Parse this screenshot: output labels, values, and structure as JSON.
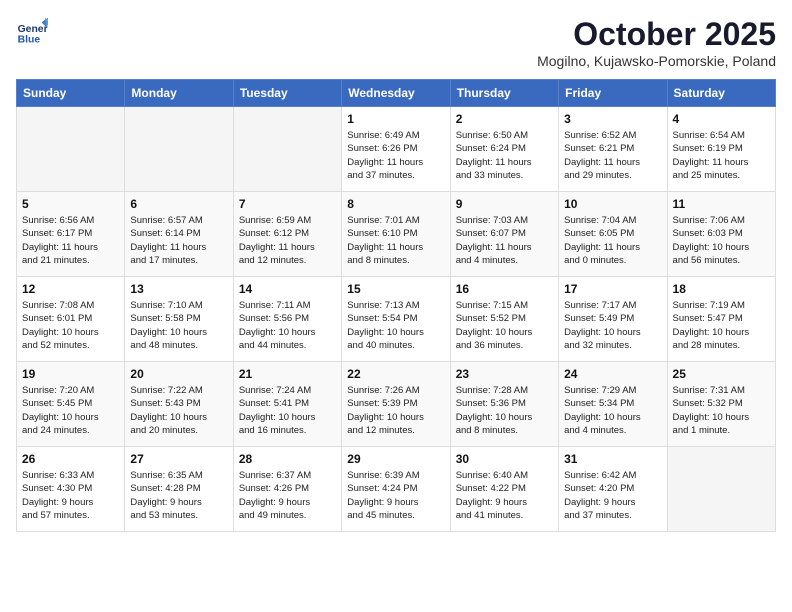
{
  "header": {
    "logo_line1": "General",
    "logo_line2": "Blue",
    "month": "October 2025",
    "location": "Mogilno, Kujawsko-Pomorskie, Poland"
  },
  "days_of_week": [
    "Sunday",
    "Monday",
    "Tuesday",
    "Wednesday",
    "Thursday",
    "Friday",
    "Saturday"
  ],
  "weeks": [
    [
      {
        "day": "",
        "info": ""
      },
      {
        "day": "",
        "info": ""
      },
      {
        "day": "",
        "info": ""
      },
      {
        "day": "1",
        "info": "Sunrise: 6:49 AM\nSunset: 6:26 PM\nDaylight: 11 hours\nand 37 minutes."
      },
      {
        "day": "2",
        "info": "Sunrise: 6:50 AM\nSunset: 6:24 PM\nDaylight: 11 hours\nand 33 minutes."
      },
      {
        "day": "3",
        "info": "Sunrise: 6:52 AM\nSunset: 6:21 PM\nDaylight: 11 hours\nand 29 minutes."
      },
      {
        "day": "4",
        "info": "Sunrise: 6:54 AM\nSunset: 6:19 PM\nDaylight: 11 hours\nand 25 minutes."
      }
    ],
    [
      {
        "day": "5",
        "info": "Sunrise: 6:56 AM\nSunset: 6:17 PM\nDaylight: 11 hours\nand 21 minutes."
      },
      {
        "day": "6",
        "info": "Sunrise: 6:57 AM\nSunset: 6:14 PM\nDaylight: 11 hours\nand 17 minutes."
      },
      {
        "day": "7",
        "info": "Sunrise: 6:59 AM\nSunset: 6:12 PM\nDaylight: 11 hours\nand 12 minutes."
      },
      {
        "day": "8",
        "info": "Sunrise: 7:01 AM\nSunset: 6:10 PM\nDaylight: 11 hours\nand 8 minutes."
      },
      {
        "day": "9",
        "info": "Sunrise: 7:03 AM\nSunset: 6:07 PM\nDaylight: 11 hours\nand 4 minutes."
      },
      {
        "day": "10",
        "info": "Sunrise: 7:04 AM\nSunset: 6:05 PM\nDaylight: 11 hours\nand 0 minutes."
      },
      {
        "day": "11",
        "info": "Sunrise: 7:06 AM\nSunset: 6:03 PM\nDaylight: 10 hours\nand 56 minutes."
      }
    ],
    [
      {
        "day": "12",
        "info": "Sunrise: 7:08 AM\nSunset: 6:01 PM\nDaylight: 10 hours\nand 52 minutes."
      },
      {
        "day": "13",
        "info": "Sunrise: 7:10 AM\nSunset: 5:58 PM\nDaylight: 10 hours\nand 48 minutes."
      },
      {
        "day": "14",
        "info": "Sunrise: 7:11 AM\nSunset: 5:56 PM\nDaylight: 10 hours\nand 44 minutes."
      },
      {
        "day": "15",
        "info": "Sunrise: 7:13 AM\nSunset: 5:54 PM\nDaylight: 10 hours\nand 40 minutes."
      },
      {
        "day": "16",
        "info": "Sunrise: 7:15 AM\nSunset: 5:52 PM\nDaylight: 10 hours\nand 36 minutes."
      },
      {
        "day": "17",
        "info": "Sunrise: 7:17 AM\nSunset: 5:49 PM\nDaylight: 10 hours\nand 32 minutes."
      },
      {
        "day": "18",
        "info": "Sunrise: 7:19 AM\nSunset: 5:47 PM\nDaylight: 10 hours\nand 28 minutes."
      }
    ],
    [
      {
        "day": "19",
        "info": "Sunrise: 7:20 AM\nSunset: 5:45 PM\nDaylight: 10 hours\nand 24 minutes."
      },
      {
        "day": "20",
        "info": "Sunrise: 7:22 AM\nSunset: 5:43 PM\nDaylight: 10 hours\nand 20 minutes."
      },
      {
        "day": "21",
        "info": "Sunrise: 7:24 AM\nSunset: 5:41 PM\nDaylight: 10 hours\nand 16 minutes."
      },
      {
        "day": "22",
        "info": "Sunrise: 7:26 AM\nSunset: 5:39 PM\nDaylight: 10 hours\nand 12 minutes."
      },
      {
        "day": "23",
        "info": "Sunrise: 7:28 AM\nSunset: 5:36 PM\nDaylight: 10 hours\nand 8 minutes."
      },
      {
        "day": "24",
        "info": "Sunrise: 7:29 AM\nSunset: 5:34 PM\nDaylight: 10 hours\nand 4 minutes."
      },
      {
        "day": "25",
        "info": "Sunrise: 7:31 AM\nSunset: 5:32 PM\nDaylight: 10 hours\nand 1 minute."
      }
    ],
    [
      {
        "day": "26",
        "info": "Sunrise: 6:33 AM\nSunset: 4:30 PM\nDaylight: 9 hours\nand 57 minutes."
      },
      {
        "day": "27",
        "info": "Sunrise: 6:35 AM\nSunset: 4:28 PM\nDaylight: 9 hours\nand 53 minutes."
      },
      {
        "day": "28",
        "info": "Sunrise: 6:37 AM\nSunset: 4:26 PM\nDaylight: 9 hours\nand 49 minutes."
      },
      {
        "day": "29",
        "info": "Sunrise: 6:39 AM\nSunset: 4:24 PM\nDaylight: 9 hours\nand 45 minutes."
      },
      {
        "day": "30",
        "info": "Sunrise: 6:40 AM\nSunset: 4:22 PM\nDaylight: 9 hours\nand 41 minutes."
      },
      {
        "day": "31",
        "info": "Sunrise: 6:42 AM\nSunset: 4:20 PM\nDaylight: 9 hours\nand 37 minutes."
      },
      {
        "day": "",
        "info": ""
      }
    ]
  ]
}
